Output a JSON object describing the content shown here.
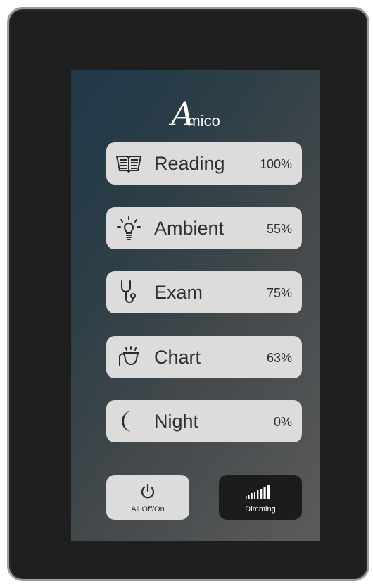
{
  "brand": {
    "initial": "A",
    "rest": "mico"
  },
  "modes": [
    {
      "label": "Reading",
      "level": "100%",
      "icon": "open-book-icon"
    },
    {
      "label": "Ambient",
      "level": "55%",
      "icon": "lightbulb-icon"
    },
    {
      "label": "Exam",
      "level": "75%",
      "icon": "stethoscope-icon"
    },
    {
      "label": "Chart",
      "level": "63%",
      "icon": "desk-lamp-icon"
    },
    {
      "label": "Night",
      "level": "0%",
      "icon": "crescent-moon-icon"
    }
  ],
  "controls": {
    "all_off_on": {
      "label": "All Off/On",
      "icon": "power-icon"
    },
    "dimming": {
      "label": "Dimming",
      "icon": "signal-bars-icon"
    }
  },
  "colors": {
    "bezel": "#1f1f1f",
    "button_light": "#dcdcdc",
    "button_dark": "#1c1c1c",
    "text_dark": "#2e2e2e"
  }
}
